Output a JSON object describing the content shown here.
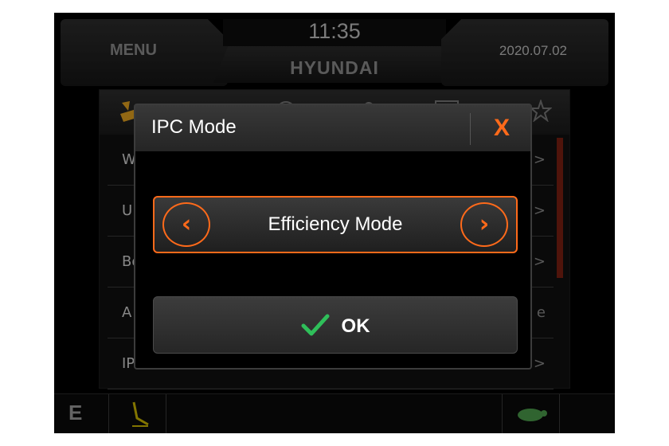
{
  "header": {
    "menu_label": "MENU",
    "clock": "11:35",
    "brand": "HYUNDAI",
    "date": "2020.07.02"
  },
  "background_list": {
    "rows": [
      {
        "label": "W",
        "arrow": ">"
      },
      {
        "label": "U",
        "arrow": ">"
      },
      {
        "label": "Bo",
        "arrow": ">"
      },
      {
        "label": "A",
        "arrow": "e"
      },
      {
        "label": "IPC Mode",
        "arrow": ">"
      }
    ]
  },
  "footer": {
    "mode_letter": "E"
  },
  "dialog": {
    "title": "IPC Mode",
    "close_label": "X",
    "selector_value": "Efficiency Mode",
    "prev_arrow": "‹",
    "next_arrow": "›",
    "ok_label": "OK"
  },
  "colors": {
    "accent": "#ff6a1a",
    "ok_check": "#2fbf5a",
    "footer_icon": "#c8b400",
    "turtle": "#4a9a4a"
  }
}
